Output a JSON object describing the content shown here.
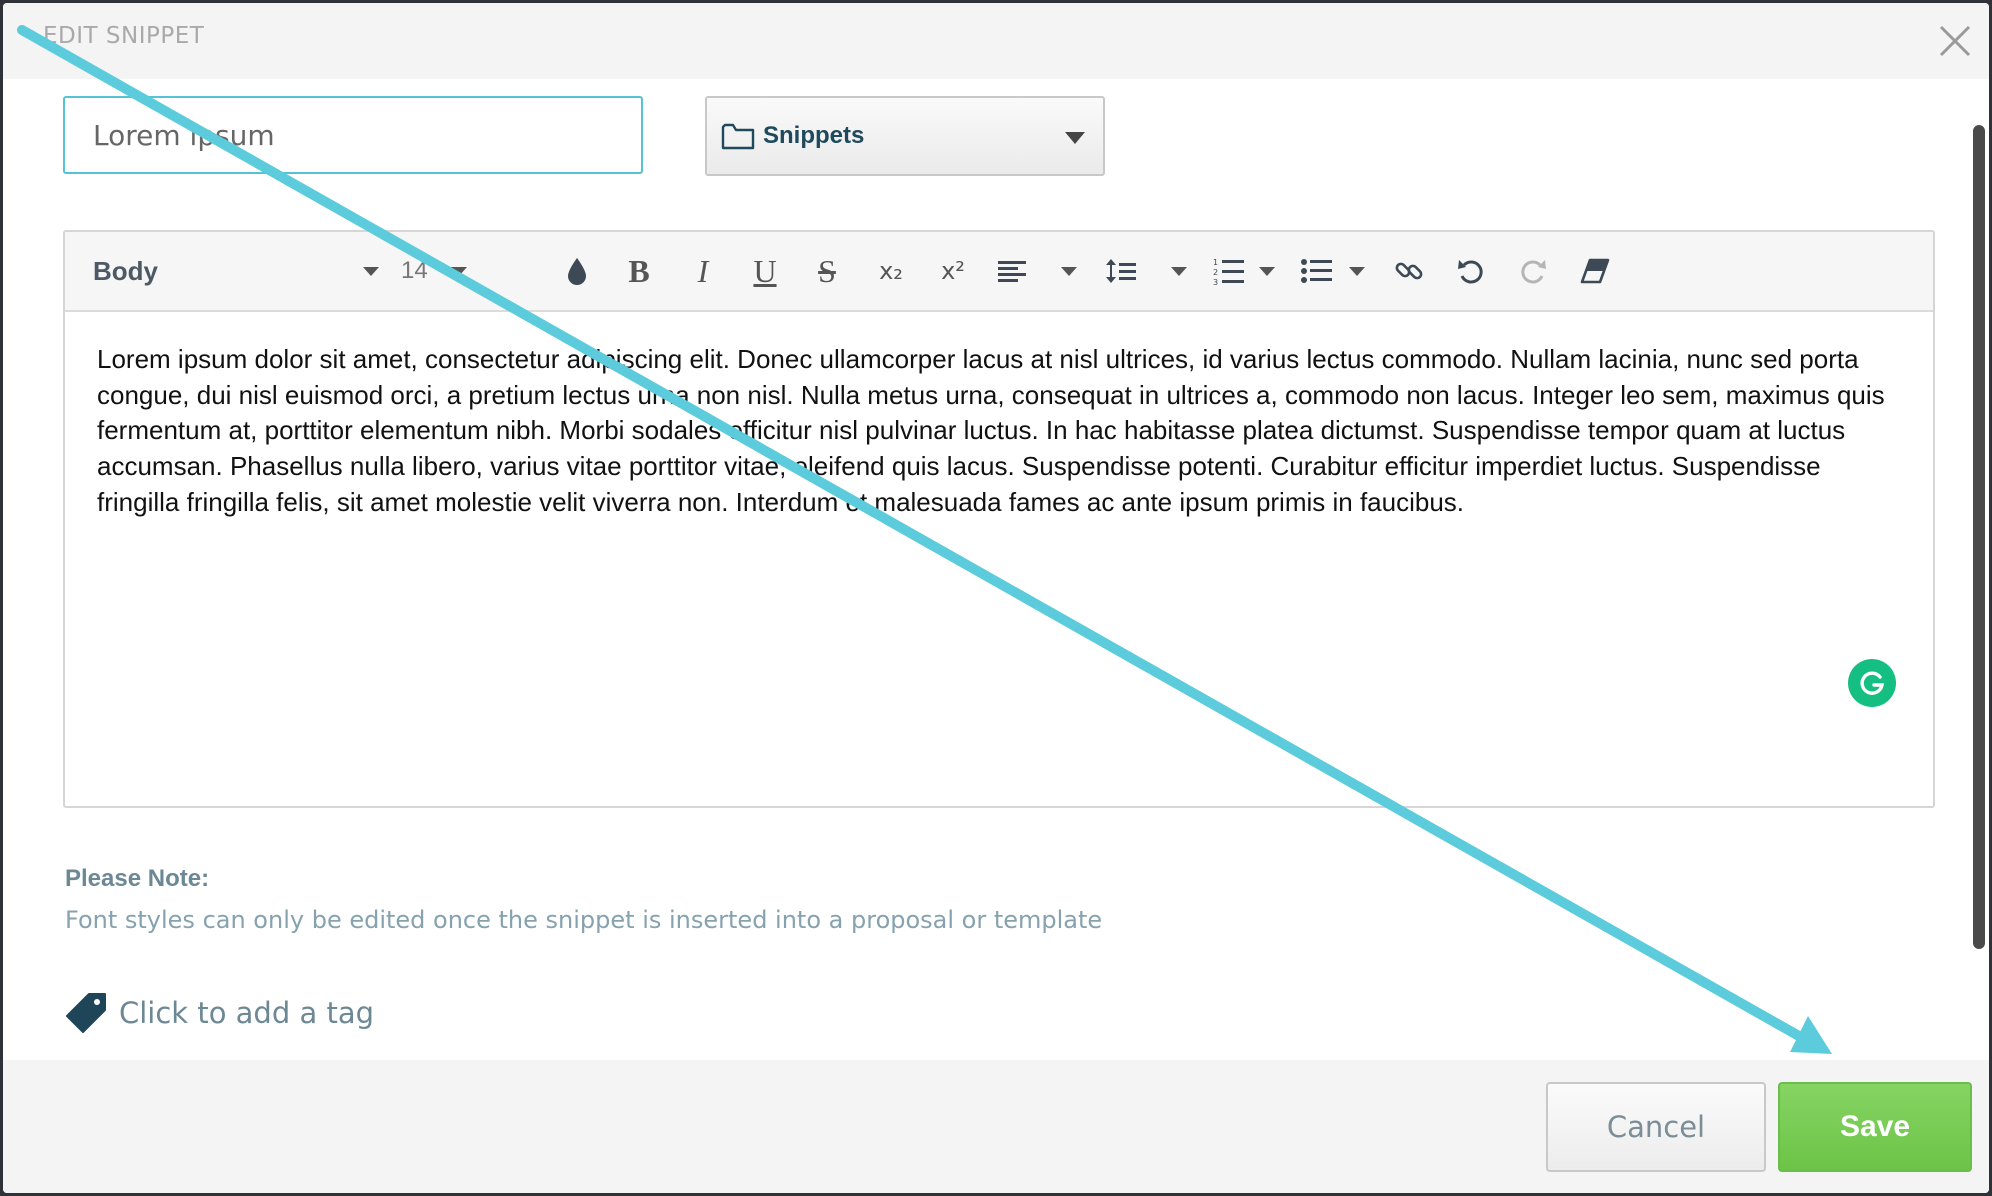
{
  "modal": {
    "title": "EDIT SNIPPET"
  },
  "form": {
    "name_value": "Lorem ipsum",
    "folder_label": "Snippets"
  },
  "toolbar": {
    "style_label": "Body",
    "size_label": "14",
    "bold_glyph": "B",
    "italic_glyph": "I",
    "underline_glyph": "U",
    "strike_glyph": "S",
    "subscript_glyph": "x₂",
    "superscript_glyph": "x²"
  },
  "editor": {
    "body_text": "Lorem ipsum dolor sit amet, consectetur adipiscing elit. Donec ullamcorper lacus at nisl ultrices, id varius lectus commodo. Nullam lacinia, nunc sed porta congue, dui nisl euismod orci, a pretium lectus urna non nisl. Nulla metus urna, consequat in ultrices a, commodo non lacus. Integer leo sem, maximus quis fermentum at, porttitor elementum nibh. Morbi sodales efficitur nisl pulvinar luctus. In hac habitasse platea dictumst. Suspendisse tempor quam at luctus accumsan. Phasellus nulla libero, varius vitae porttitor vitae, eleifend quis lacus. Suspendisse potenti. Curabitur efficitur imperdiet luctus. Suspendisse fringilla fringilla felis, sit amet molestie velit viverra non. Interdum et malesuada fames ac ante ipsum primis in faucibus."
  },
  "note": {
    "title": "Please Note:",
    "text": "Font styles can only be edited once the snippet is inserted into a proposal or template"
  },
  "tag": {
    "label": "Click to add a tag"
  },
  "footer": {
    "cancel_label": "Cancel",
    "save_label": "Save"
  },
  "colors": {
    "accent_input_border": "#56c2d6",
    "save_green": "#6cc447",
    "grammarly_green": "#15bf81",
    "annotation_arrow": "#5ccbdc"
  },
  "icons": [
    "close-icon",
    "folder-icon",
    "caret-down-icon",
    "text-color-icon",
    "bold-icon",
    "italic-icon",
    "underline-icon",
    "strikethrough-icon",
    "subscript-icon",
    "superscript-icon",
    "align-left-icon",
    "line-height-icon",
    "numbered-list-icon",
    "bullet-list-icon",
    "link-icon",
    "undo-icon",
    "redo-icon",
    "clear-format-icon",
    "grammarly-icon",
    "tag-icon"
  ]
}
